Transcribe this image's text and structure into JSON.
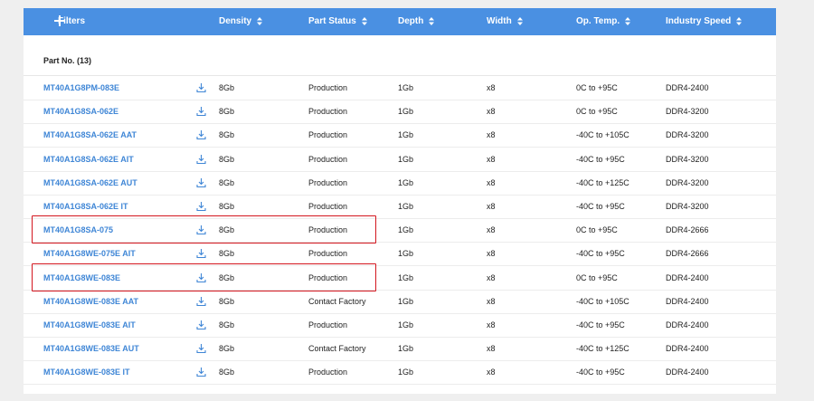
{
  "header": {
    "filters_label": "Filters",
    "columns": [
      "Density",
      "Part Status",
      "Depth",
      "Width",
      "Op. Temp.",
      "Industry Speed"
    ]
  },
  "part_count_label": "Part No. (13)",
  "rows": [
    {
      "part": "MT40A1G8PM-083E",
      "density": "8Gb",
      "status": "Production",
      "depth": "1Gb",
      "width": "x8",
      "temp": "0C to +95C",
      "speed": "DDR4-2400"
    },
    {
      "part": "MT40A1G8SA-062E",
      "density": "8Gb",
      "status": "Production",
      "depth": "1Gb",
      "width": "x8",
      "temp": "0C to +95C",
      "speed": "DDR4-3200"
    },
    {
      "part": "MT40A1G8SA-062E AAT",
      "density": "8Gb",
      "status": "Production",
      "depth": "1Gb",
      "width": "x8",
      "temp": "-40C to +105C",
      "speed": "DDR4-3200"
    },
    {
      "part": "MT40A1G8SA-062E AIT",
      "density": "8Gb",
      "status": "Production",
      "depth": "1Gb",
      "width": "x8",
      "temp": "-40C to +95C",
      "speed": "DDR4-3200"
    },
    {
      "part": "MT40A1G8SA-062E AUT",
      "density": "8Gb",
      "status": "Production",
      "depth": "1Gb",
      "width": "x8",
      "temp": "-40C to +125C",
      "speed": "DDR4-3200"
    },
    {
      "part": "MT40A1G8SA-062E IT",
      "density": "8Gb",
      "status": "Production",
      "depth": "1Gb",
      "width": "x8",
      "temp": "-40C to +95C",
      "speed": "DDR4-3200"
    },
    {
      "part": "MT40A1G8SA-075",
      "density": "8Gb",
      "status": "Production",
      "depth": "1Gb",
      "width": "x8",
      "temp": "0C to +95C",
      "speed": "DDR4-2666"
    },
    {
      "part": "MT40A1G8WE-075E AIT",
      "density": "8Gb",
      "status": "Production",
      "depth": "1Gb",
      "width": "x8",
      "temp": "-40C to +95C",
      "speed": "DDR4-2666"
    },
    {
      "part": "MT40A1G8WE-083E",
      "density": "8Gb",
      "status": "Production",
      "depth": "1Gb",
      "width": "x8",
      "temp": "0C to +95C",
      "speed": "DDR4-2400"
    },
    {
      "part": "MT40A1G8WE-083E AAT",
      "density": "8Gb",
      "status": "Contact Factory",
      "depth": "1Gb",
      "width": "x8",
      "temp": "-40C to +105C",
      "speed": "DDR4-2400"
    },
    {
      "part": "MT40A1G8WE-083E AIT",
      "density": "8Gb",
      "status": "Production",
      "depth": "1Gb",
      "width": "x8",
      "temp": "-40C to +95C",
      "speed": "DDR4-2400"
    },
    {
      "part": "MT40A1G8WE-083E AUT",
      "density": "8Gb",
      "status": "Contact Factory",
      "depth": "1Gb",
      "width": "x8",
      "temp": "-40C to +125C",
      "speed": "DDR4-2400"
    },
    {
      "part": "MT40A1G8WE-083E IT",
      "density": "8Gb",
      "status": "Production",
      "depth": "1Gb",
      "width": "x8",
      "temp": "-40C to +95C",
      "speed": "DDR4-2400"
    }
  ],
  "highlighted_rows": [
    6,
    8
  ],
  "icons": {
    "add": "plus-icon",
    "sort": "sort-icon",
    "download": "download-icon"
  },
  "colors": {
    "header_bg": "#4a90e2",
    "link": "#3f86d6",
    "highlight": "#d3161e"
  }
}
